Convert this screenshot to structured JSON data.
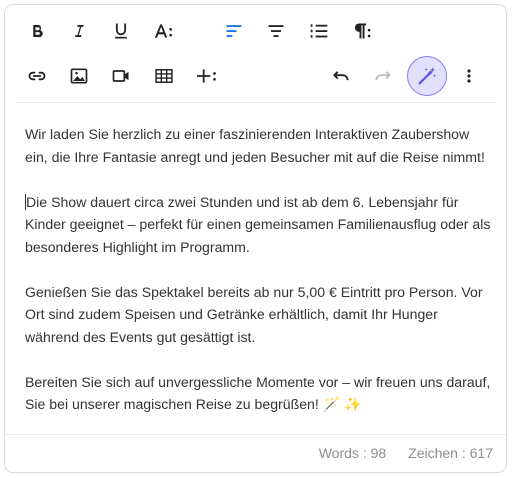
{
  "toolbar": {
    "row1": [
      {
        "name": "bold-button",
        "icon": "bold-icon",
        "active": false
      },
      {
        "name": "italic-button",
        "icon": "italic-icon",
        "active": false
      },
      {
        "name": "underline-button",
        "icon": "underline-icon",
        "active": false
      },
      {
        "name": "font-size-button",
        "icon": "font-size-icon",
        "active": false
      },
      {
        "name": "align-left-button",
        "icon": "align-left-icon",
        "active": true
      },
      {
        "name": "align-center-button",
        "icon": "align-center-icon",
        "active": false
      },
      {
        "name": "numbered-list-button",
        "icon": "numbered-list-icon",
        "active": false
      },
      {
        "name": "paragraph-button",
        "icon": "paragraph-icon",
        "active": false
      }
    ],
    "row2": [
      {
        "name": "link-button",
        "icon": "link-icon"
      },
      {
        "name": "image-button",
        "icon": "image-icon"
      },
      {
        "name": "video-button",
        "icon": "video-icon"
      },
      {
        "name": "table-button",
        "icon": "table-icon"
      },
      {
        "name": "insert-more-button",
        "icon": "plus-more-icon"
      },
      {
        "name": "undo-button",
        "icon": "undo-icon",
        "disabled": false
      },
      {
        "name": "redo-button",
        "icon": "redo-icon",
        "disabled": true
      },
      {
        "name": "ai-magic-button",
        "icon": "magic-wand-icon",
        "highlighted": true
      },
      {
        "name": "more-options-button",
        "icon": "vertical-dots-icon"
      }
    ],
    "accent_color": "#1a73e8",
    "magic_bg_color": "#e3e0fb"
  },
  "content": {
    "paragraphs": [
      "Wir laden Sie herzlich zu einer faszinierenden Interaktiven Zaubershow ein, die Ihre Fantasie anregt und jeden Besucher mit auf die Reise nimmt!",
      "Die Show dauert circa zwei Stunden und ist ab dem 6. Lebensjahr für Kinder geeignet – perfekt für einen gemeinsamen Familienausflug oder als besonderes Highlight im Programm.",
      "Genießen Sie das Spektakel bereits ab nur 5,00 € Eintritt pro Person. Vor Ort sind zudem Speisen und Getränke erhältlich, damit Ihr Hunger während des Events gut gesättigt ist.",
      "Bereiten Sie sich auf unvergessliche Momente vor – wir freuen uns darauf, Sie bei unserer magischen Reise zu begrüßen! 🪄 ✨"
    ]
  },
  "footer": {
    "words": "Words : 98",
    "chars": "Zeichen : 617"
  }
}
